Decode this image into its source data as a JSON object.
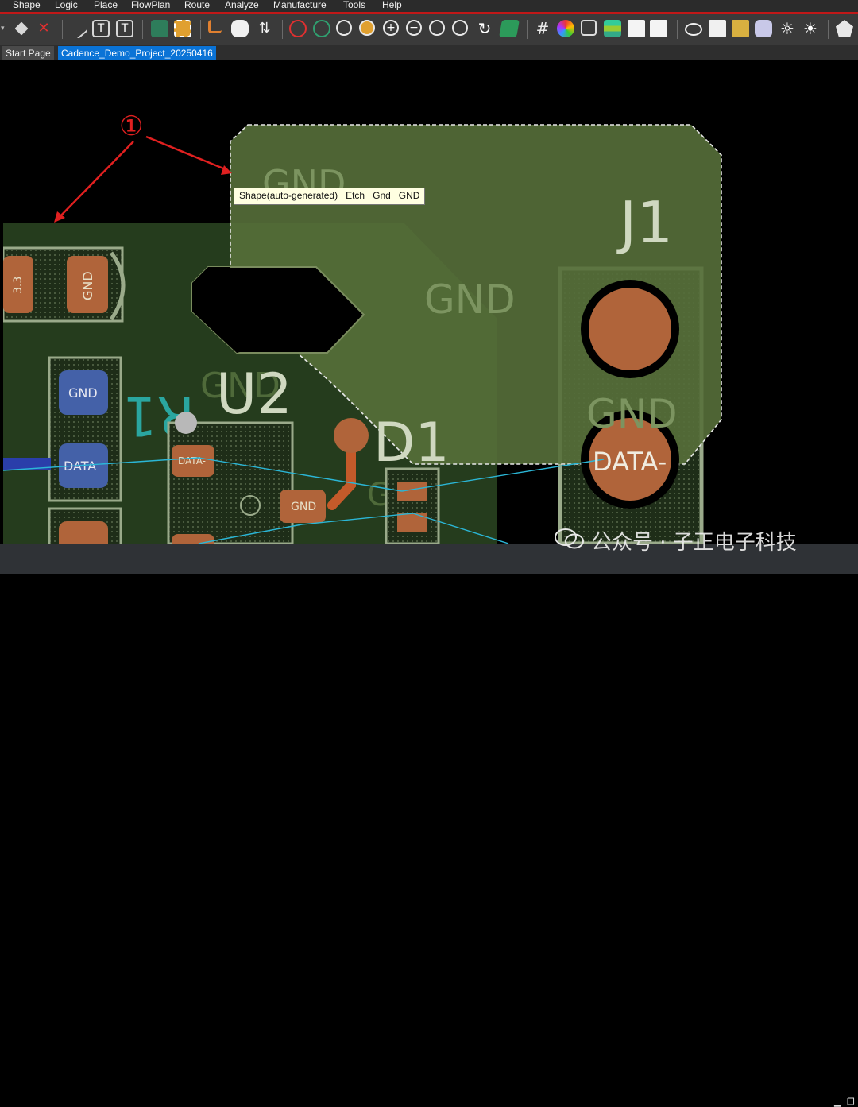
{
  "menu": [
    "Shape",
    "Logic",
    "Place",
    "FlowPlan",
    "Route",
    "Analyze",
    "Manufacture",
    "Tools",
    "Help"
  ],
  "tabs": {
    "start_page": "Start Page",
    "project": "Cadence_Demo_Project_20250416"
  },
  "toolbar_icons": [
    "pin-icon",
    "unpin-icon",
    "add-line-icon",
    "add-text-icon",
    "edit-text-icon",
    "place-component-icon",
    "chip-icon",
    "route-icon",
    "slide-icon",
    "swap-pins-icon",
    "drc-icon",
    "net-icon",
    "zoom-out-fit-icon",
    "zoom-previous-icon",
    "zoom-in-icon",
    "zoom-out-icon",
    "zoom-world-icon",
    "zoom-center-icon",
    "redraw-icon",
    "3d-view-icon",
    "grid-icon",
    "color-icon",
    "layer-icon",
    "stackup-icon",
    "report-icon",
    "settings-icon",
    "visibility-icon",
    "info-icon",
    "measure-icon",
    "highlight-icon",
    "shadow-icon",
    "dehighlight-icon",
    "shape-icon"
  ],
  "tooltip": "Shape(auto-generated)   Etch   Gnd   GND",
  "annotation": "①",
  "board": {
    "refdes": {
      "j1": "J1",
      "u2": "U2",
      "d1": "D1",
      "r1": "R1"
    },
    "net_labels": {
      "gnd": "GND",
      "data_minus": "DATA-",
      "data": "DATA",
      "v33": "3.3"
    }
  },
  "watermark": "公众号 · 子正电子科技",
  "colors": {
    "menu_accent": "#c01818",
    "tab_active": "#0a73d6",
    "shape_fill": "#566f3a",
    "board_fill": "#253c1d",
    "pad_copper": "#b0643a",
    "pad_blue": "#4461a8",
    "ratsnest": "#2bb6d6",
    "silk": "#cfd8c0"
  }
}
